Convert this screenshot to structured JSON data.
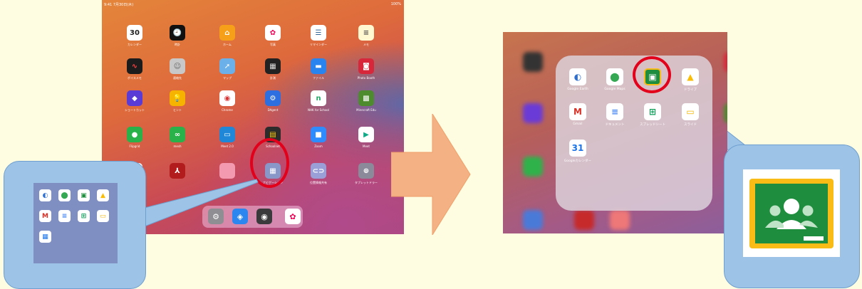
{
  "left_screen": {
    "status_time": "9:41  7月30日(木)",
    "status_battery": "100%",
    "apps": [
      {
        "label": "カレンダー",
        "glyph": "30",
        "color": "#ffffff",
        "fg": "#222"
      },
      {
        "label": "時計",
        "glyph": "🕘",
        "color": "#111111",
        "fg": "#fff"
      },
      {
        "label": "ホーム",
        "glyph": "⌂",
        "color": "#f6a01a",
        "fg": "#fff"
      },
      {
        "label": "写真",
        "glyph": "✿",
        "color": "#ffffff",
        "fg": "#e05"
      },
      {
        "label": "リマインダー",
        "glyph": "☰",
        "color": "#ffffff",
        "fg": "#369"
      },
      {
        "label": "メモ",
        "glyph": "≡",
        "color": "#fff8d0",
        "fg": "#555"
      },
      {
        "label": "ボイスメモ",
        "glyph": "∿",
        "color": "#1c1c1c",
        "fg": "#f44"
      },
      {
        "label": "連絡先",
        "glyph": "☺",
        "color": "#c8c8c8",
        "fg": "#666"
      },
      {
        "label": "マップ",
        "glyph": "➚",
        "color": "#6bb0e8",
        "fg": "#fff"
      },
      {
        "label": "計測",
        "glyph": "▦",
        "color": "#222222",
        "fg": "#ddd"
      },
      {
        "label": "ファイル",
        "glyph": "▬",
        "color": "#2a84f0",
        "fg": "#fff"
      },
      {
        "label": "Photo Booth",
        "glyph": "◙",
        "color": "#d6283a",
        "fg": "#fff"
      },
      {
        "label": "ショートカット",
        "glyph": "◆",
        "color": "#5a3bd6",
        "fg": "#fff"
      },
      {
        "label": "ヒント",
        "glyph": "💡",
        "color": "#f6b400",
        "fg": "#fff"
      },
      {
        "label": "Chrome",
        "glyph": "◉",
        "color": "#ffffff",
        "fg": "#d33"
      },
      {
        "label": "DAgent",
        "glyph": "⚙",
        "color": "#2d6ee0",
        "fg": "#fff"
      },
      {
        "label": "NHK for School",
        "glyph": "n",
        "color": "#ffffff",
        "fg": "#2a6"
      },
      {
        "label": "Minecraft Edu",
        "glyph": "▩",
        "color": "#4e8a2e",
        "fg": "#fff"
      },
      {
        "label": "Flipgrid",
        "glyph": "●",
        "color": "#29b24a",
        "fg": "#fff"
      },
      {
        "label": "mesh",
        "glyph": "∞",
        "color": "#29b24a",
        "fg": "#fff"
      },
      {
        "label": "Meet 2.0",
        "glyph": "▭",
        "color": "#1e87d8",
        "fg": "#fff"
      },
      {
        "label": "Schoolnet",
        "glyph": "▤",
        "color": "#2c2c2c",
        "fg": "#fc0"
      },
      {
        "label": "Zoom",
        "glyph": "■",
        "color": "#2d8cff",
        "fg": "#fff"
      },
      {
        "label": "Meet",
        "glyph": "▶",
        "color": "#ffffff",
        "fg": "#1a8"
      },
      {
        "label": "",
        "glyph": "",
        "color": "#ffffff",
        "fg": "#333"
      },
      {
        "label": "",
        "glyph": "⅄",
        "color": "#b21c1c",
        "fg": "#fff"
      },
      {
        "label": "",
        "glyph": "",
        "color": "#f49ab0",
        "fg": "#fff"
      },
      {
        "label": "ナビゲーション",
        "glyph": "▦",
        "color": "#8897c8",
        "fg": "#fff"
      },
      {
        "label": "位置情報共有",
        "glyph": "⊂⊃",
        "color": "#9a9fd8",
        "fg": "#fff"
      },
      {
        "label": "タブレットドラー",
        "glyph": "⊕",
        "color": "#8a8a9a",
        "fg": "#fff"
      }
    ],
    "dock": [
      {
        "name": "settings",
        "glyph": "⚙",
        "color": "#8e8e93"
      },
      {
        "name": "safari",
        "glyph": "◈",
        "color": "#2b86f0"
      },
      {
        "name": "camera",
        "glyph": "◉",
        "color": "#3a3a3c"
      },
      {
        "name": "photos",
        "glyph": "✿",
        "color": "#ffffff"
      }
    ]
  },
  "left_callout": {
    "apps": [
      {
        "glyph": "◐",
        "fg": "#2e6fd0"
      },
      {
        "glyph": "⬤",
        "fg": "#34a853"
      },
      {
        "glyph": "▣",
        "fg": "#1e8e3e"
      },
      {
        "glyph": "▲",
        "fg": "#fbbc04"
      },
      {
        "glyph": "M",
        "fg": "#d93025"
      },
      {
        "glyph": "≡",
        "fg": "#4285f4"
      },
      {
        "glyph": "⊞",
        "fg": "#0f9d58"
      },
      {
        "glyph": "▭",
        "fg": "#f4b400"
      },
      {
        "glyph": "▦",
        "fg": "#1a73e8"
      }
    ]
  },
  "folder": {
    "apps": [
      {
        "label": "Google Earth",
        "glyph": "◐",
        "fg": "#2e6fd0"
      },
      {
        "label": "Google Maps",
        "glyph": "⬤",
        "fg": "#34a853"
      },
      {
        "label": "Classroom",
        "glyph": "▣",
        "fg": "#1e8e3e"
      },
      {
        "label": "ドライブ",
        "glyph": "▲",
        "fg": "#fbbc04"
      },
      {
        "label": "Gmail",
        "glyph": "M",
        "fg": "#d93025"
      },
      {
        "label": "ドキュメント",
        "glyph": "≡",
        "fg": "#4285f4"
      },
      {
        "label": "スプレッドシート",
        "glyph": "⊞",
        "fg": "#0f9d58"
      },
      {
        "label": "スライド",
        "glyph": "▭",
        "fg": "#f4b400"
      },
      {
        "label": "Googleカレンダー",
        "glyph": "31",
        "fg": "#1a73e8"
      }
    ]
  },
  "colors": {
    "background": "#fefde2",
    "callout": "#9dc3e6",
    "highlight_ring": "#e3001b",
    "arrow": "#f4b183",
    "classroom_green": "#1e8e3e",
    "classroom_yellow": "#f9bc16"
  }
}
